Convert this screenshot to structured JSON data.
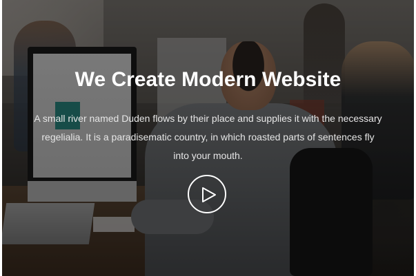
{
  "hero": {
    "title": "We Create Modern Website",
    "description": "A small river named Duden flows by their place and supplies it with the necessary regelialia. It is a paradisematic country, in which roasted parts of sentences fly into your mouth.",
    "play_icon": "play-icon",
    "colors": {
      "text": "#ffffff",
      "overlay": "rgba(0,0,0,0.45)"
    }
  }
}
